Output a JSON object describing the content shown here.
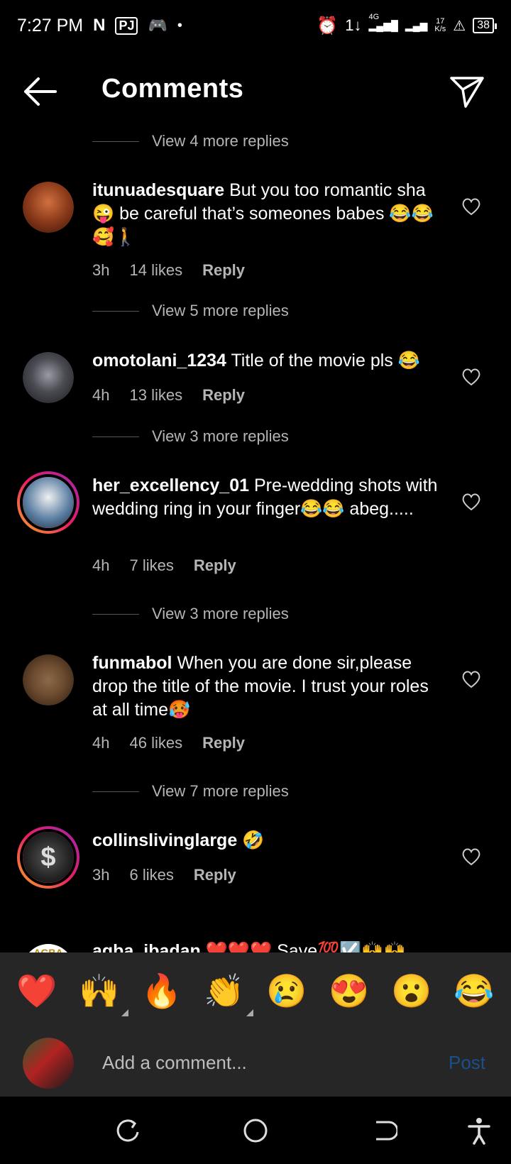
{
  "status_bar": {
    "time": "7:27 PM",
    "network": "4G",
    "speed_value": "17",
    "speed_unit": "K/s",
    "battery": "38"
  },
  "header": {
    "title": "Comments"
  },
  "replies_links": [
    "View 4 more replies",
    "View 5 more replies",
    "View 3 more replies",
    "View 3 more replies",
    "View 7 more replies"
  ],
  "comments": [
    {
      "username": "itunuadesquare",
      "text": "But you too romantic sha 😜 be careful that’s someones babes 😂😂🥰🚶",
      "time": "3h",
      "likes": "14 likes",
      "reply": "Reply",
      "avatar_color": "#8b3a1a"
    },
    {
      "username": "omotolani_1234",
      "text": "Title of the movie pls 😂",
      "time": "4h",
      "likes": "13 likes",
      "reply": "Reply",
      "avatar_color": "#4a4a52"
    },
    {
      "username": "her_excellency_01",
      "text": "Pre-wedding shots with wedding ring in your finger😂😂 abeg.....",
      "time": "4h",
      "likes": "7 likes",
      "reply": "Reply",
      "avatar_color": "#5b7fa3"
    },
    {
      "username": "funmabol",
      "text": "When you are done sir,please drop the title of the movie. I trust your roles at all time🥵",
      "time": "4h",
      "likes": "46 likes",
      "reply": "Reply",
      "avatar_color": "#6b4a2e"
    },
    {
      "username": "collinslivinglarge",
      "text": "🤣",
      "time": "3h",
      "likes": "6 likes",
      "reply": "Reply",
      "avatar_color": "#333333"
    }
  ],
  "partial_comment": {
    "avatar_label": "AGBA",
    "username": "agba_ibadan",
    "text": "❤️❤️❤️ Save💯☑️🙌🙌"
  },
  "reactions": [
    "❤️",
    "🙌",
    "🔥",
    "👏",
    "😢",
    "😍",
    "😮",
    "😂"
  ],
  "composer": {
    "placeholder": "Add a comment...",
    "post_label": "Post"
  },
  "colors": {
    "background": "#000000",
    "panel": "#262626",
    "muted_text": "#b5b5b5",
    "post_disabled": "#1a4f8a",
    "story_ring_start": "#f9a825",
    "story_ring_end": "#9c27b0"
  }
}
